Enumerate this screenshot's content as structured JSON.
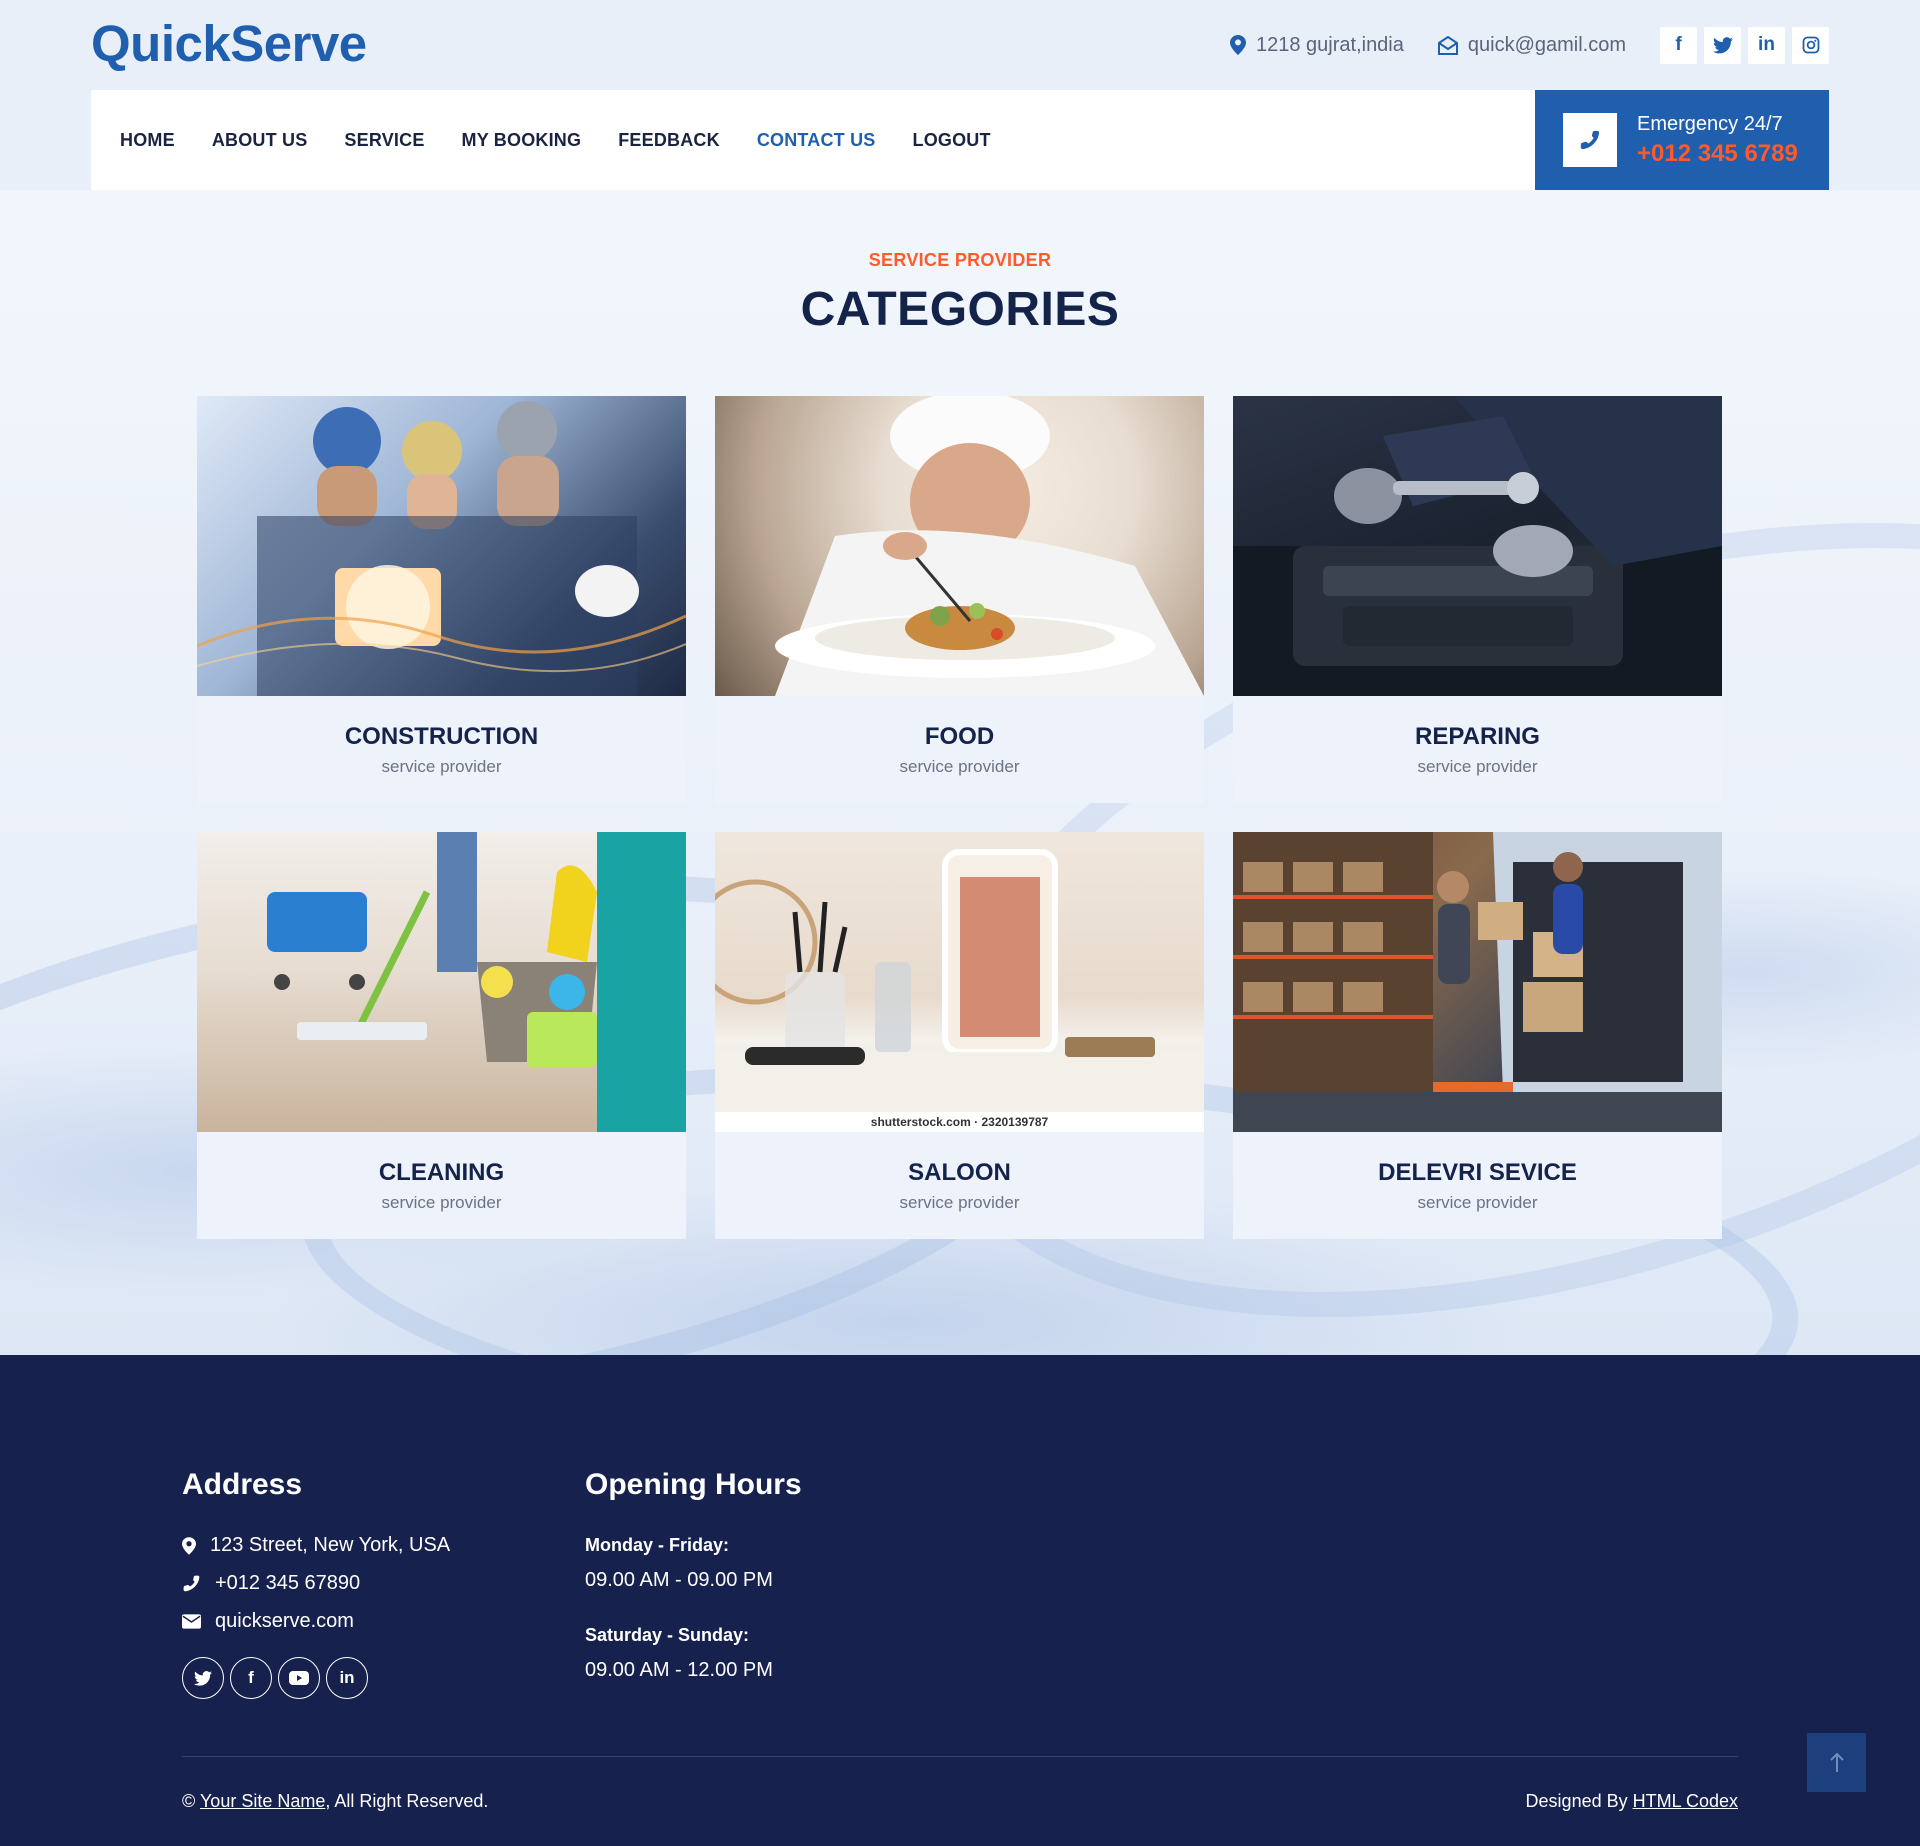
{
  "brand": {
    "logo": "QuickServe",
    "accent_color": "#1f5fae",
    "highlight_color": "#ff5a2c"
  },
  "topbar": {
    "address": "1218 gujrat,india",
    "email": "quick@gamil.com",
    "socials": [
      {
        "icon": "facebook-icon",
        "glyph": "f"
      },
      {
        "icon": "twitter-icon",
        "glyph": "t"
      },
      {
        "icon": "linkedin-icon",
        "glyph": "in"
      },
      {
        "icon": "instagram-icon",
        "glyph": "◎"
      }
    ]
  },
  "nav": {
    "items": [
      {
        "label": "HOME"
      },
      {
        "label": "ABOUT US"
      },
      {
        "label": "SERVICE"
      },
      {
        "label": "MY BOOKING"
      },
      {
        "label": "FEEDBACK"
      },
      {
        "label": "CONTACT US",
        "active": true
      },
      {
        "label": "LOGOUT"
      }
    ],
    "emergency": {
      "title": "Emergency 24/7",
      "phone": "+012 345 6789"
    }
  },
  "section": {
    "eyebrow": "SERVICE PROVIDER",
    "title": "CATEGORIES"
  },
  "categories": [
    {
      "title": "CONSTRUCTION",
      "subtitle": "service provider",
      "image": "construction-workers-photo"
    },
    {
      "title": "FOOD",
      "subtitle": "service provider",
      "image": "chef-plating-photo"
    },
    {
      "title": "REPARING",
      "subtitle": "service provider",
      "image": "engine-repair-photo"
    },
    {
      "title": "CLEANING",
      "subtitle": "service provider",
      "image": "cleaning-supplies-photo"
    },
    {
      "title": "SALOON",
      "subtitle": "service provider",
      "image": "salon-station-photo",
      "watermark": "shutterstock.com · 2320139787"
    },
    {
      "title": "DELEVRI SEVICE",
      "subtitle": "service provider",
      "image": "delivery-van-photo"
    }
  ],
  "footer": {
    "address": {
      "title": "Address",
      "street": "123 Street, New York, USA",
      "phone": "+012 345 67890",
      "email": "quickserve.com",
      "socials": [
        {
          "icon": "twitter-icon",
          "glyph": "t"
        },
        {
          "icon": "facebook-icon",
          "glyph": "f"
        },
        {
          "icon": "youtube-icon",
          "glyph": "▶"
        },
        {
          "icon": "linkedin-icon",
          "glyph": "in"
        }
      ]
    },
    "hours": {
      "title": "Opening Hours",
      "weekday_label": "Monday - Friday:",
      "weekday_time": "09.00 AM - 09.00 PM",
      "weekend_label": "Saturday - Sunday:",
      "weekend_time": "09.00 AM - 12.00 PM"
    },
    "copyright_prefix": "©",
    "site_name_link": "Your Site Name",
    "copyright_suffix": ", All Right Reserved.",
    "designed_by_prefix": "Designed By",
    "designer_link": "HTML Codex"
  }
}
